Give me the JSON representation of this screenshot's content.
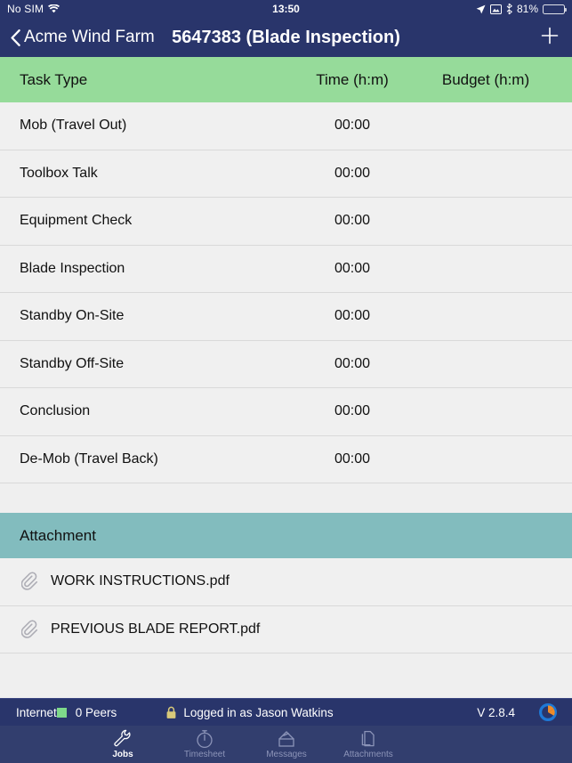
{
  "ios_status": {
    "carrier": "No SIM",
    "wifi_icon": "wifi-icon",
    "time": "13:50",
    "location_icon": "location-arrow-icon",
    "screen_icon": "screen-mirroring-icon",
    "bluetooth_icon": "bluetooth-icon",
    "battery_percent": "81%",
    "battery_level": 81
  },
  "navbar": {
    "back_icon": "chevron-left-icon",
    "back_label": "Acme Wind Farm",
    "title": "5647383 (Blade Inspection)",
    "add_icon": "plus-icon"
  },
  "tasks_section": {
    "columns": {
      "task": "Task Type",
      "time": "Time (h:m)",
      "budget": "Budget (h:m)"
    },
    "rows": [
      {
        "task": "Mob (Travel Out)",
        "time": "00:00",
        "budget": ""
      },
      {
        "task": "Toolbox Talk",
        "time": "00:00",
        "budget": ""
      },
      {
        "task": "Equipment Check",
        "time": "00:00",
        "budget": ""
      },
      {
        "task": "Blade Inspection",
        "time": "00:00",
        "budget": ""
      },
      {
        "task": "Standby On-Site",
        "time": "00:00",
        "budget": ""
      },
      {
        "task": "Standby Off-Site",
        "time": "00:00",
        "budget": ""
      },
      {
        "task": "Conclusion",
        "time": "00:00",
        "budget": ""
      },
      {
        "task": "De-Mob (Travel Back)",
        "time": "00:00",
        "budget": ""
      }
    ]
  },
  "attachment_section": {
    "header": "Attachment",
    "items": [
      {
        "icon": "paperclip-icon",
        "name": "WORK INSTRUCTIONS.pdf"
      },
      {
        "icon": "paperclip-icon",
        "name": "PREVIOUS BLADE REPORT.pdf"
      }
    ]
  },
  "statusbar": {
    "network_label": "Internet",
    "network_status_color": "#7ED98A",
    "peers_label": "0 Peers",
    "lock_icon": "lock-icon",
    "login_label": "Logged in as Jason Watkins",
    "version_label": "V 2.8.4",
    "logo_icon": "sync-logo-icon"
  },
  "tabbar": {
    "tabs": [
      {
        "icon": "wrench-icon",
        "label": "Jobs",
        "active": true
      },
      {
        "icon": "stopwatch-icon",
        "label": "Timesheet",
        "active": false
      },
      {
        "icon": "inbox-icon",
        "label": "Messages",
        "active": false
      },
      {
        "icon": "documents-icon",
        "label": "Attachments",
        "active": false
      }
    ]
  },
  "colors": {
    "navy": "#29356B",
    "green_header": "#96DB9A",
    "teal_header": "#82BCBE",
    "row_bg": "#F0F0F0",
    "page_bg": "#EFEFEF"
  }
}
